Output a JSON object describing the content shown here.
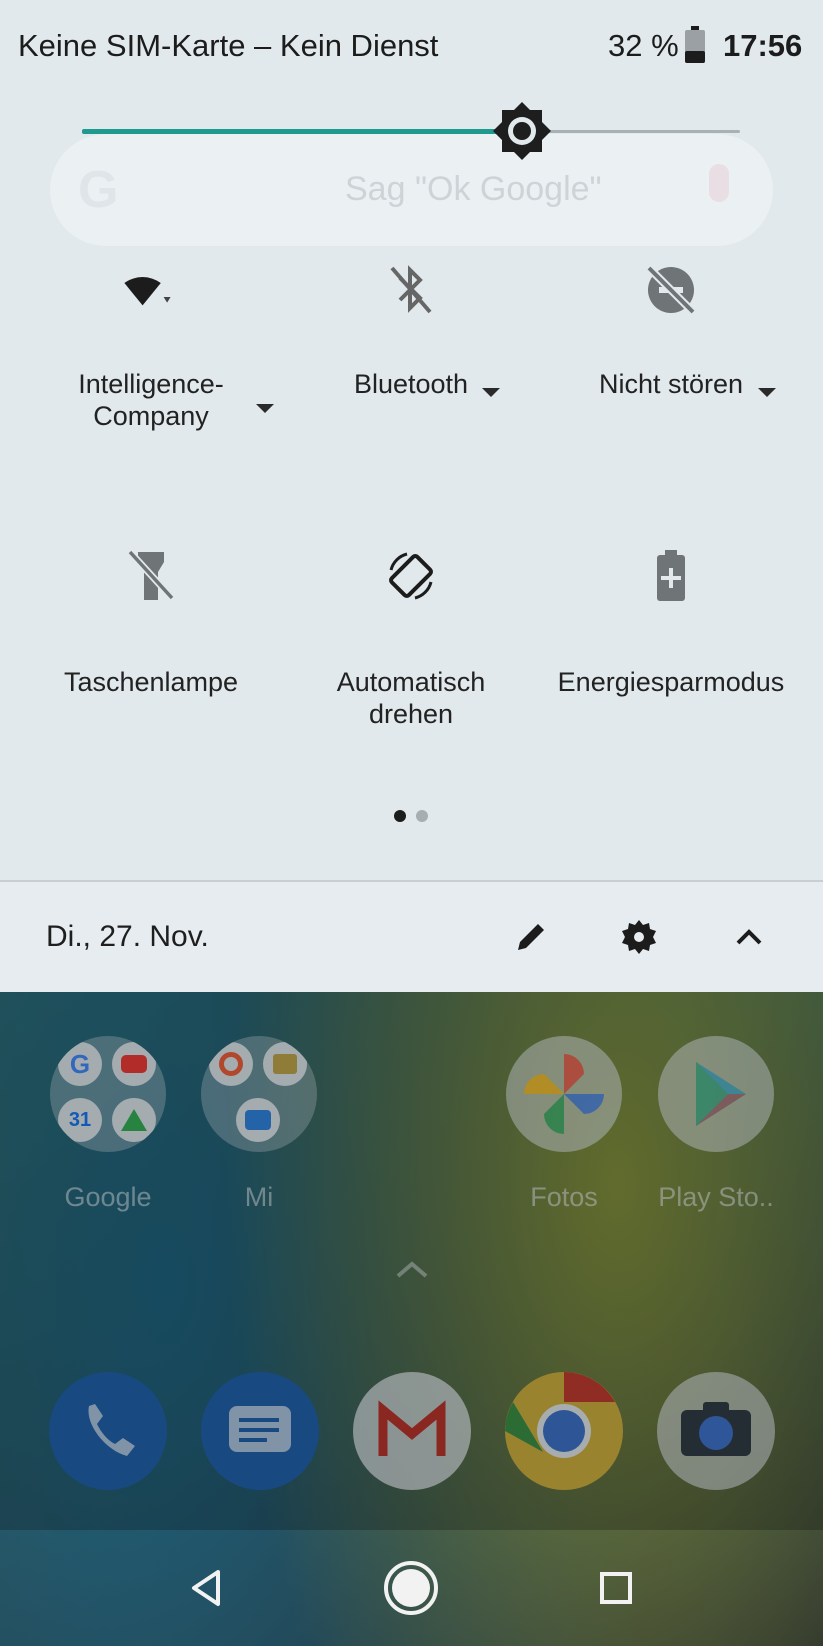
{
  "status_bar": {
    "carrier": "Keine SIM-Karte – Kein Dienst",
    "battery_percent": "32 %",
    "time": "17:56"
  },
  "brightness": {
    "level": 0.66
  },
  "search_bar": {
    "placeholder": "Sag \"Ok Google\""
  },
  "tiles": [
    {
      "label": "Intelligence-\nCompany",
      "icon": "wifi-icon",
      "has_dropdown": true
    },
    {
      "label": "Bluetooth",
      "icon": "bluetooth-disabled-icon",
      "has_dropdown": true
    },
    {
      "label": "Nicht stören",
      "icon": "do-not-disturb-off-icon",
      "has_dropdown": true
    },
    {
      "label": "Taschenlampe",
      "icon": "flashlight-off-icon",
      "has_dropdown": false
    },
    {
      "label": "Automatisch\ndrehen",
      "icon": "auto-rotate-icon",
      "has_dropdown": false
    },
    {
      "label": "Energiesparmodus",
      "icon": "battery-saver-icon",
      "has_dropdown": false
    }
  ],
  "pages": {
    "current": 1,
    "total": 2
  },
  "footer": {
    "date": "Di., 27. Nov.",
    "icons": [
      "edit-icon",
      "settings-icon",
      "collapse-icon"
    ]
  },
  "home": {
    "apps": [
      {
        "label": "Google",
        "icon": "google-folder-icon"
      },
      {
        "label": "Mi",
        "icon": "mi-folder-icon"
      },
      {
        "label": "Fotos",
        "icon": "photos-icon"
      },
      {
        "label": "Play Sto..",
        "icon": "play-store-icon"
      }
    ],
    "dock": [
      "phone-icon",
      "messages-icon",
      "gmail-icon",
      "chrome-icon",
      "camera-icon"
    ]
  },
  "nav": [
    "back-icon",
    "home-icon",
    "recents-icon"
  ],
  "colors": {
    "accent": "#1e9a8f",
    "shade_bg": "#e1e9ec",
    "text": "#222222"
  }
}
